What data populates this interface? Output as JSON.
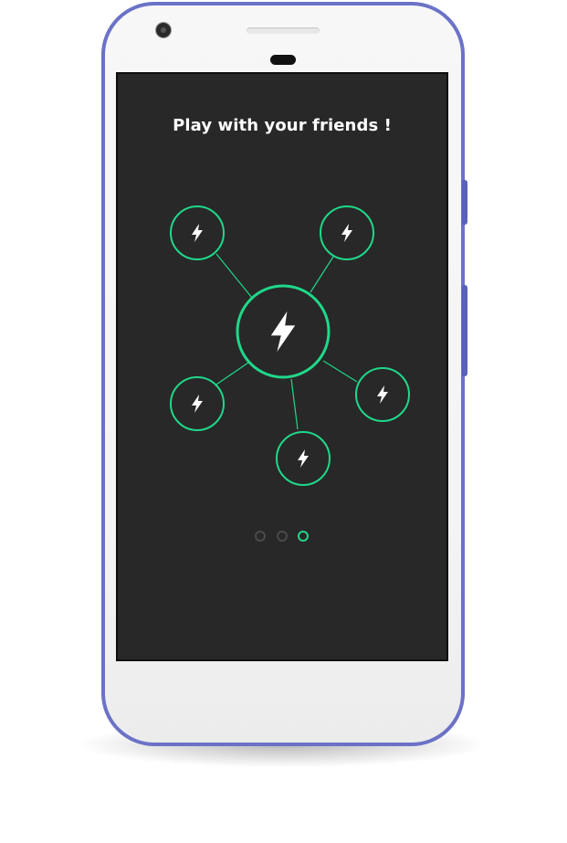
{
  "screen": {
    "title": "Play with your friends !"
  },
  "colors": {
    "phone_frame": "#6b72c6",
    "screen_background": "#282828",
    "accent": "#1fd88a",
    "icon": "#ffffff",
    "dot_inactive": "#4a4a4a"
  },
  "network": {
    "center_icon": "lightning-bolt-icon",
    "satellite_icon": "lightning-bolt-icon",
    "satellite_count": 5
  },
  "pager": {
    "total_pages": 3,
    "current_page": 3
  }
}
